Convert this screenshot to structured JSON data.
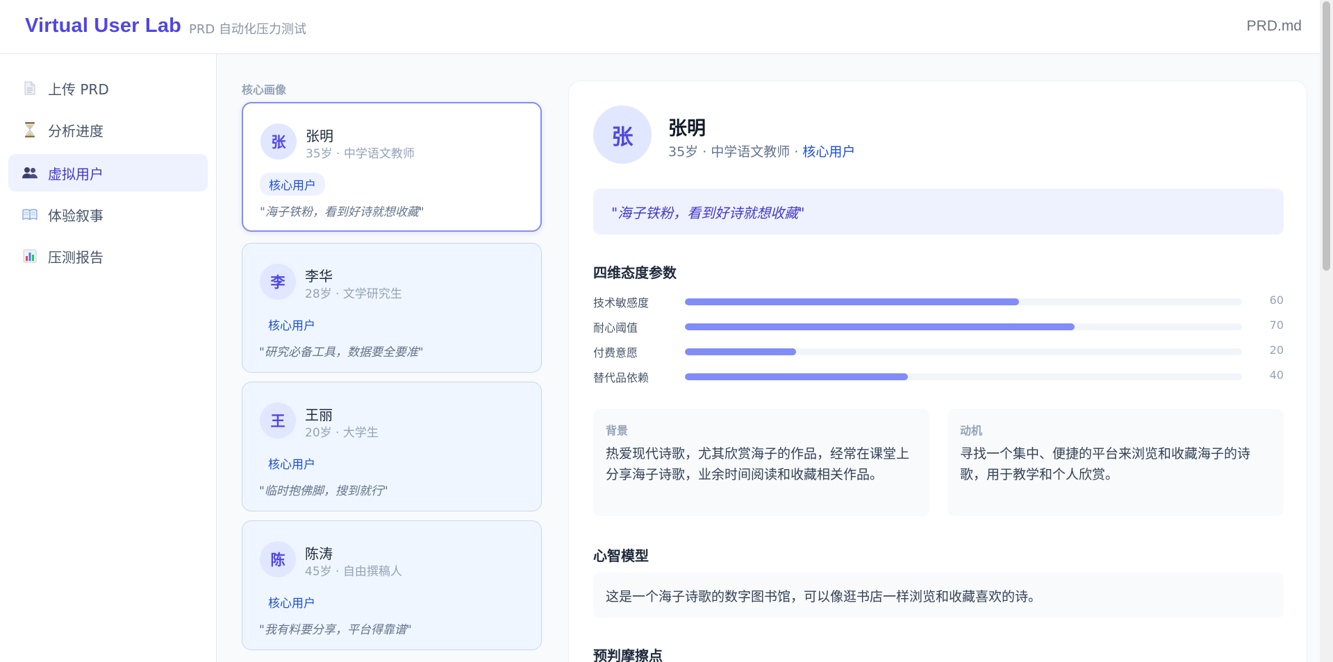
{
  "header": {
    "brand": "Virtual User Lab",
    "subtitle": "PRD 自动化压力测试",
    "file": "PRD.md"
  },
  "sidebar": {
    "items": [
      {
        "label": "上传 PRD",
        "icon": "document-icon",
        "active": false
      },
      {
        "label": "分析进度",
        "icon": "hourglass-icon",
        "active": false
      },
      {
        "label": "虚拟用户",
        "icon": "users-icon",
        "active": true
      },
      {
        "label": "体验叙事",
        "icon": "book-icon",
        "active": false
      },
      {
        "label": "压测报告",
        "icon": "bar-chart-icon",
        "active": false
      }
    ]
  },
  "persona_list": {
    "title": "核心画像",
    "personas": [
      {
        "avatar": "张",
        "name": "张明",
        "meta": "35岁 · 中学语文教师",
        "tag": "核心用户",
        "quote": "\"海子铁粉，看到好诗就想收藏\"",
        "selected": true
      },
      {
        "avatar": "李",
        "name": "李华",
        "meta": "28岁 · 文学研究生",
        "tag": "核心用户",
        "quote": "\"研究必备工具，数据要全要准\"",
        "selected": false
      },
      {
        "avatar": "王",
        "name": "王丽",
        "meta": "20岁 · 大学生",
        "tag": "核心用户",
        "quote": "\"临时抱佛脚，搜到就行\"",
        "selected": false
      },
      {
        "avatar": "陈",
        "name": "陈涛",
        "meta": "45岁 · 自由撰稿人",
        "tag": "核心用户",
        "quote": "\"我有料要分享，平台得靠谱\"",
        "selected": false
      }
    ]
  },
  "detail": {
    "avatar": "张",
    "name": "张明",
    "meta": "35岁 · 中学语文教师 · ",
    "tag": "核心用户",
    "quote": "\"海子铁粉，看到好诗就想收藏\"",
    "metrics_title": "四维态度参数",
    "metrics": [
      {
        "label": "技术敏感度",
        "value": 60
      },
      {
        "label": "耐心阈值",
        "value": 70
      },
      {
        "label": "付费意愿",
        "value": 20
      },
      {
        "label": "替代品依赖",
        "value": 40
      }
    ],
    "background": {
      "title": "背景",
      "text": "热爱现代诗歌，尤其欣赏海子的作品，经常在课堂上分享海子诗歌，业余时间阅读和收藏相关作品。"
    },
    "motivation": {
      "title": "动机",
      "text": "寻找一个集中、便捷的平台来浏览和收藏海子的诗歌，用于教学和个人欣赏。"
    },
    "mental_model_title": "心智模型",
    "mental_model": "这是一个海子诗歌的数字图书馆，可以像逛书店一样浏览和收藏喜欢的诗。",
    "friction_title": "预判摩擦点"
  },
  "colors": {
    "accent": "#4f46e5",
    "bar": "#818cf8",
    "tag": "#1d4ed8"
  }
}
